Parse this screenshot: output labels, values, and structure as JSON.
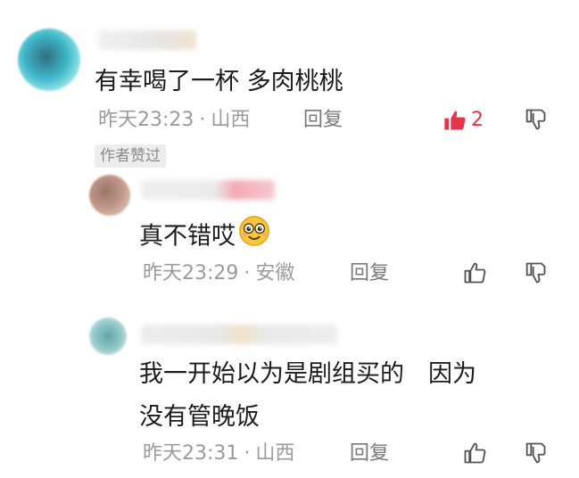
{
  "comments": [
    {
      "text": "有幸喝了一杯 多肉桃桃",
      "time": "昨天23:23",
      "location": "山西",
      "reply_label": "回复",
      "like_count": "2",
      "liked": true,
      "badge": "作者赞过"
    },
    {
      "text": "真不错哎",
      "emoji": "smiley-face-icon",
      "time": "昨天23:29",
      "location": "安徽",
      "reply_label": "回复"
    },
    {
      "text_line1": "我一开始以为是剧组买的　因为",
      "text_line2": "没有管晚饭",
      "time": "昨天23:31",
      "location": "山西",
      "reply_label": "回复"
    }
  ],
  "separator": "·",
  "colors": {
    "like_active": "#e2344a",
    "meta_gray": "#9b9b9b",
    "badge_bg": "#ededed"
  }
}
